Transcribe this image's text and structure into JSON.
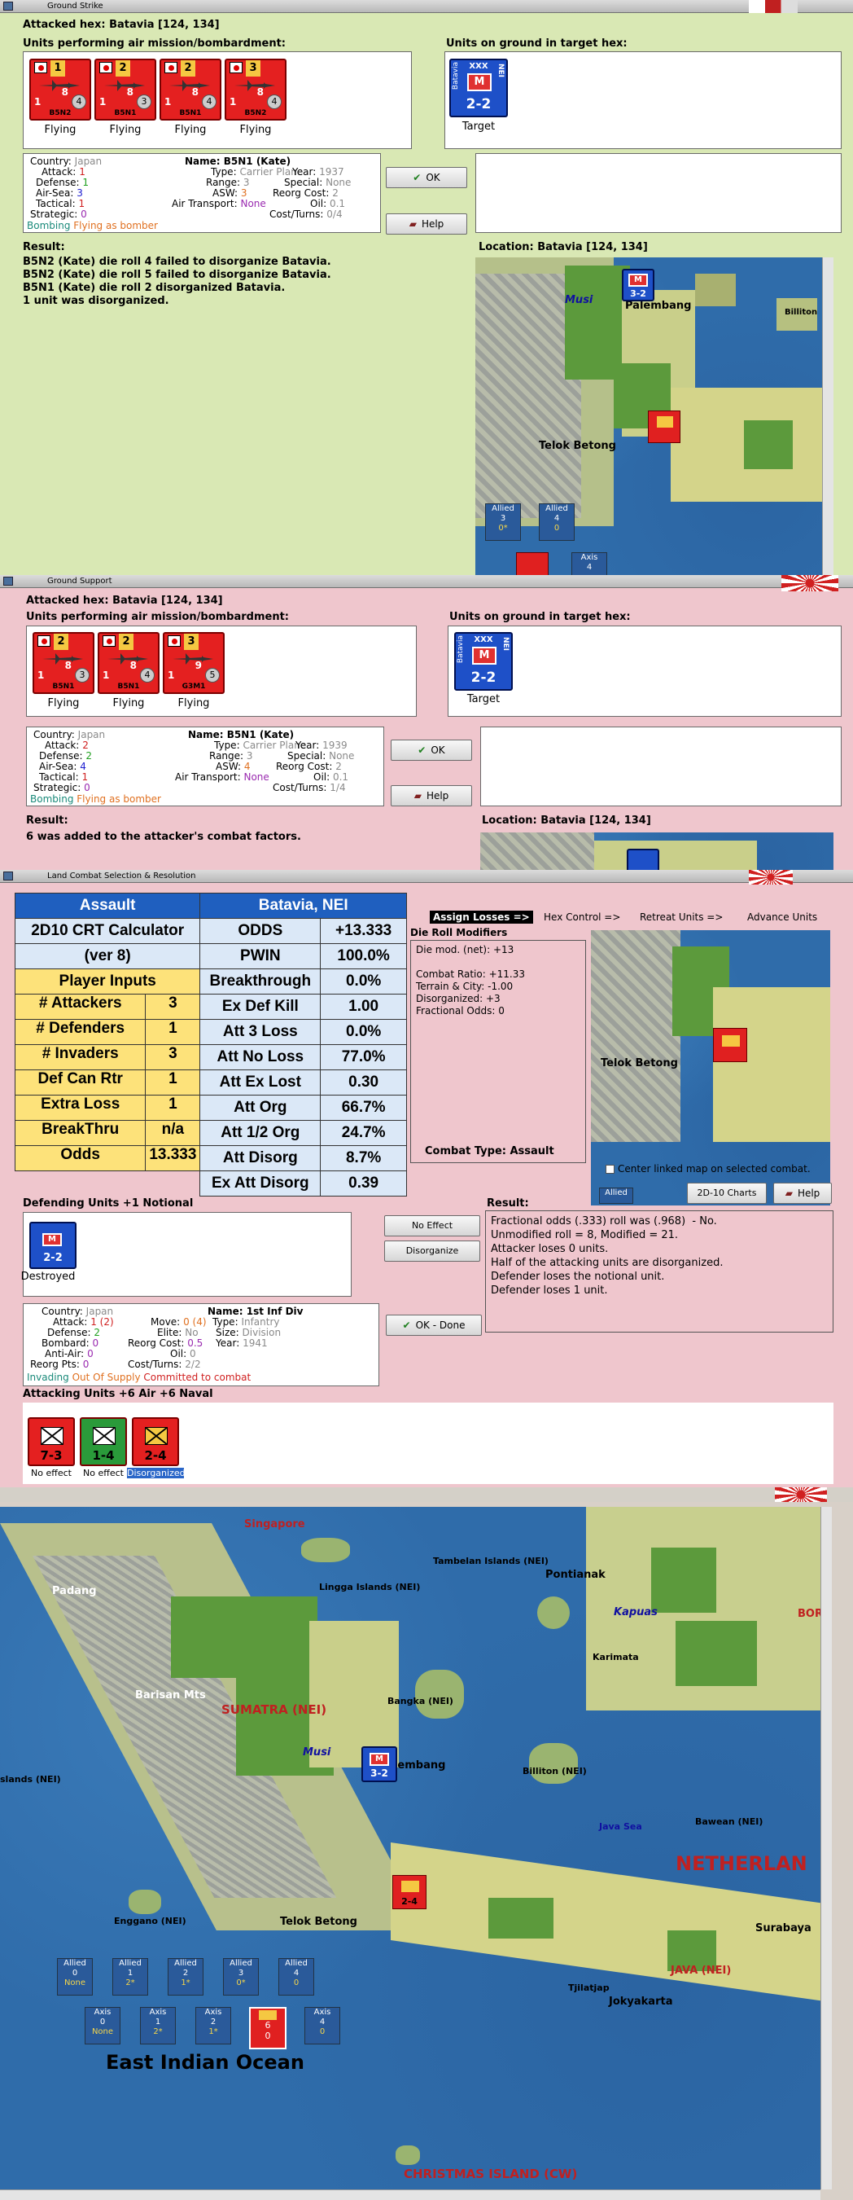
{
  "window1": {
    "title": "Ground Strike",
    "attacked_hex": "Attacked hex: Batavia  [124, 134]",
    "units_label": "Units performing air mission/bombardment:",
    "ground_label": "Units on ground in target hex:",
    "units": [
      {
        "top": "1",
        "name": "B5N2",
        "bl": "1",
        "br": "8",
        "circle": "4",
        "status": "Flying"
      },
      {
        "top": "2",
        "name": "B5N1",
        "bl": "1",
        "br": "8",
        "circle": "3",
        "status": "Flying"
      },
      {
        "top": "2",
        "name": "B5N1",
        "bl": "1",
        "br": "8",
        "circle": "4",
        "status": "Flying"
      },
      {
        "top": "3",
        "name": "B5N2",
        "bl": "1",
        "br": "8",
        "circle": "4",
        "status": "Flying"
      }
    ],
    "target": {
      "side": "Batavia",
      "size": "XXX",
      "nation": "NEI",
      "type": "M",
      "strength": "2-2",
      "caption": "Target"
    },
    "info": {
      "country_k": "Country:",
      "country": "Japan",
      "attack_k": "Attack:",
      "attack": "1",
      "defense_k": "Defense:",
      "defense": "1",
      "airsea_k": "Air-Sea:",
      "airsea": "3",
      "tactical_k": "Tactical:",
      "tactical": "1",
      "strategic_k": "Strategic:",
      "strategic": "0",
      "name": "Name: B5N1 (Kate)",
      "type_k": "Type:",
      "type": "Carrier Plane",
      "year_k": "Year:",
      "year": "1937",
      "range_k": "Range:",
      "range": "3",
      "special_k": "Special:",
      "special": "None",
      "asw_k": "ASW:",
      "asw": "3",
      "reorg_k": "Reorg Cost:",
      "reorg": "2",
      "oil_k": "Oil:",
      "oil": "0.1",
      "airtrans_k": "Air Transport:",
      "airtrans": "None",
      "cost_k": "Cost/Turns:",
      "cost": "0/4",
      "bombing": "Bombing",
      "flying": "Flying as bomber"
    },
    "ok": "OK",
    "help": "Help",
    "result_label": "Result:",
    "result_text": "B5N2 (Kate) die roll 4 failed to disorganize Batavia.\nB5N2 (Kate) die roll 5 failed to disorganize Batavia.\nB5N1 (Kate) die roll 2 disorganized Batavia.\n1 unit was disorganized.",
    "location": "Location:  Batavia  [124, 134]",
    "map": {
      "river": "Musi",
      "town1": "Palembang",
      "town2": "Telok Betong",
      "town3": "Billiton",
      "unit_str": "3-2",
      "allied1": "Allied",
      "allied1_v": "3",
      "allied1_s": "0*",
      "allied2": "Allied",
      "allied2_v": "4",
      "allied2_s": "0",
      "axis": "Axis",
      "axis_v": "4"
    }
  },
  "window2": {
    "title": "Ground Support",
    "attacked_hex": "Attacked hex: Batavia  [124, 134]",
    "units_label": "Units performing air mission/bombardment:",
    "ground_label": "Units on ground in target hex:",
    "units": [
      {
        "top": "2",
        "name": "B5N1",
        "bl": "1",
        "br": "8",
        "circle": "3",
        "status": "Flying"
      },
      {
        "top": "2",
        "name": "B5N1",
        "bl": "1",
        "br": "8",
        "circle": "4",
        "status": "Flying"
      },
      {
        "top": "3",
        "name": "G3M1",
        "bl": "1",
        "br": "9",
        "circle": "5",
        "status": "Flying"
      }
    ],
    "target": {
      "side": "Batavia",
      "size": "XXX",
      "nation": "NEI",
      "type": "M",
      "strength": "2-2",
      "caption": "Target"
    },
    "info": {
      "country_k": "Country:",
      "country": "Japan",
      "attack_k": "Attack:",
      "attack": "2",
      "defense_k": "Defense:",
      "defense": "2",
      "airsea_k": "Air-Sea:",
      "airsea": "4",
      "tactical_k": "Tactical:",
      "tactical": "1",
      "strategic_k": "Strategic:",
      "strategic": "0",
      "name": "Name: B5N1 (Kate)",
      "type_k": "Type:",
      "type": "Carrier Plane",
      "year_k": "Year:",
      "year": "1939",
      "range_k": "Range:",
      "range": "3",
      "special_k": "Special:",
      "special": "None",
      "asw_k": "ASW:",
      "asw": "4",
      "reorg_k": "Reorg Cost:",
      "reorg": "2",
      "oil_k": "Oil:",
      "oil": "0.1",
      "airtrans_k": "Air Transport:",
      "airtrans": "None",
      "cost_k": "Cost/Turns:",
      "cost": "1/4",
      "bombing": "Bombing",
      "flying": "Flying as bomber"
    },
    "ok": "OK",
    "help": "Help",
    "result_label": "Result:",
    "result_text": "6 was added to the attacker's combat factors.",
    "location": "Location:  Batavia  [124, 134]"
  },
  "window3": {
    "title": "Land Combat Selection & Resolution",
    "crt": {
      "h1": "Assault",
      "h2": "Batavia, NEI",
      "calc": "2D10 CRT Calculator",
      "ver": "(ver 8)",
      "inputs": "Player Inputs",
      "left": [
        {
          "k": "# Attackers",
          "v": "3"
        },
        {
          "k": "# Defenders",
          "v": "1"
        },
        {
          "k": "# Invaders",
          "v": "3"
        },
        {
          "k": "Def Can Rtr",
          "v": "1"
        },
        {
          "k": "Extra Loss",
          "v": "1"
        },
        {
          "k": "BreakThru",
          "v": "n/a"
        },
        {
          "k": "Odds",
          "v": "13.333"
        }
      ],
      "right": [
        {
          "k": "ODDS",
          "v": "+13.333"
        },
        {
          "k": "PWIN",
          "v": "100.0%"
        },
        {
          "k": "Breakthrough",
          "v": "0.0%"
        },
        {
          "k": "Ex Def Kill",
          "v": "1.00"
        },
        {
          "k": "Att 3 Loss",
          "v": "0.0%"
        },
        {
          "k": "Att No Loss",
          "v": "77.0%"
        },
        {
          "k": "Att Ex Lost",
          "v": "0.30"
        },
        {
          "k": "Att Org",
          "v": "66.7%"
        },
        {
          "k": "Att 1/2 Org",
          "v": "24.7%"
        },
        {
          "k": "Att Disorg",
          "v": "8.7%"
        },
        {
          "k": "Ex Att Disorg",
          "v": "0.39"
        }
      ]
    },
    "steps": [
      "Assign Losses =>",
      "Hex Control =>",
      "Retreat Units =>",
      "Advance Units"
    ],
    "dice_label": "Die Roll Modifiers",
    "dice_text": "Die mod. (net): +13\n\nCombat Ratio: +11.33\nTerrain & City: -1.00\nDisorganized: +3\nFractional Odds: 0",
    "combat_type": "Combat Type:  Assault",
    "center_chk": "Center linked map on selected combat.",
    "charts_btn": "2D-10 Charts",
    "help": "Help",
    "defending_label": "Defending Units +1 Notional",
    "defender": {
      "strength": "2-2",
      "caption": "Destroyed"
    },
    "no_effect": "No Effect",
    "disorganize": "Disorganize",
    "ok_done": "OK - Done",
    "result_label": "Result:",
    "result_text": "Fractional odds (.333) roll was (.968)  - No.\nUnmodified roll = 8, Modified = 21.\nAttacker loses 0 units.\nHalf of the attacking units are disorganized.\nDefender loses the notional unit.\nDefender loses 1 unit.",
    "info": {
      "country_k": "Country:",
      "country": "Japan",
      "attack_k": "Attack:",
      "attack": "1 (2)",
      "defense_k": "Defense:",
      "defense": "2",
      "bombard_k": "Bombard:",
      "bombard": "0",
      "antiair_k": "Anti-Air:",
      "antiair": "0",
      "reorgpts_k": "Reorg Pts:",
      "reorgpts": "0",
      "move_k": "Move:",
      "move": "0 (4)",
      "elite_k": "Elite:",
      "elite": "No",
      "reorg_k": "Reorg Cost:",
      "reorg": "0.5",
      "oil_k": "Oil:",
      "oil": "0",
      "cost_k": "Cost/Turns:",
      "cost": "2/2",
      "name": "Name: 1st Inf Div",
      "type_k": "Type:",
      "type": "Infantry",
      "size_k": "Size:",
      "size": "Division",
      "year_k": "Year:",
      "year": "1941",
      "invading": "Invading",
      "oos": "Out Of Supply",
      "committed": "Committed to combat"
    },
    "attacking_label": "Attacking Units +6 Air +6 Naval",
    "attackers": [
      {
        "str": "7-3",
        "caption": "No effect"
      },
      {
        "str": "1-4",
        "caption": "No effect"
      },
      {
        "str": "2-4",
        "caption": "Disorganized"
      }
    ],
    "map": {
      "town": "Telok Betong",
      "allied": "Allied"
    }
  },
  "window4": {
    "labels": {
      "singapore": "Singapore",
      "padang": "Padang",
      "lingga": "Lingga Islands (NEI)",
      "tambelan": "Tambelan Islands (NEI)",
      "pontianak": "Pontianak",
      "kapuas": "Kapuas",
      "karimata": "Karimata",
      "barisan": "Barisan Mts",
      "sumatra": "SUMATRA (NEI)",
      "bangka": "Bangka (NEI)",
      "musi": "Musi",
      "palembang": "Palembang",
      "billiton": "Billiton (NEI)",
      "java_sea": "Java Sea",
      "bawean": "Bawean (NEI)",
      "netherlands": "NETHERLAN",
      "enggano": "Enggano (NEI)",
      "telok": "Telok Betong",
      "surabaya": "Surabaya",
      "java": "JAVA (NEI)",
      "tjilatjap": "Tjilatjap",
      "jokyakarta": "Jokyakarta",
      "ocean": "East Indian Ocean",
      "christmas": "CHRISTMAS ISLAND (CW)",
      "islands": "slands (NEI)",
      "bor": "BOR"
    },
    "unit_str": "3-2",
    "unit2_str": "2-4",
    "allied": [
      {
        "l": "Allied",
        "v": "0",
        "s": "None"
      },
      {
        "l": "Allied",
        "v": "1",
        "s": "2*"
      },
      {
        "l": "Allied",
        "v": "2",
        "s": "1*"
      },
      {
        "l": "Allied",
        "v": "3",
        "s": "0*"
      },
      {
        "l": "Allied",
        "v": "4",
        "s": "0"
      }
    ],
    "axis": [
      {
        "l": "Axis",
        "v": "0",
        "s": "None"
      },
      {
        "l": "Axis",
        "v": "1",
        "s": "2*"
      },
      {
        "l": "Axis",
        "v": "2",
        "s": "1*"
      },
      {
        "l": "Axis",
        "v": "4",
        "s": "0"
      }
    ],
    "axis_red": {
      "v": "6",
      "s": "0"
    }
  },
  "colors": {
    "pane1_bg": "#d9e8b4",
    "pane2_bg": "#efc6cd",
    "pane3_bg": "#efc6cd",
    "crt_header": "#1f5fbf",
    "sea": "#2f6caa"
  }
}
